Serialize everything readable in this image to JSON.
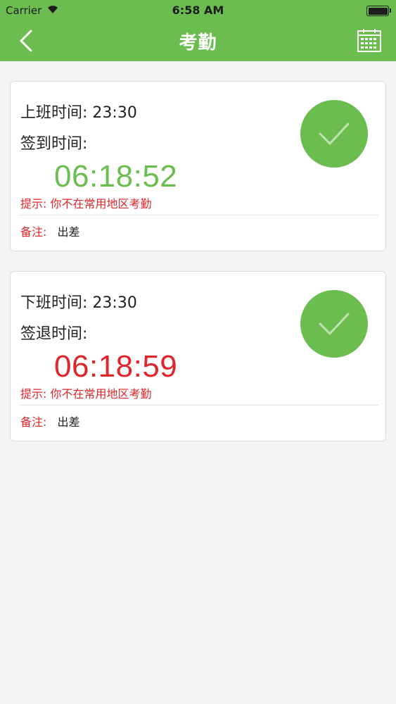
{
  "status": {
    "carrier": "Carrier",
    "time": "6:58 AM"
  },
  "nav": {
    "title": "考勤"
  },
  "checkin": {
    "shift_label": "上班时间:",
    "shift_time": "23:30",
    "sign_label": "签到时间:",
    "sign_time": "06:18:52",
    "hint": "提示: 你不在常用地区考勤",
    "remark_label": "备注:",
    "remark_value": "出差"
  },
  "checkout": {
    "shift_label": "下班时间:",
    "shift_time": "23:30",
    "sign_label": "签退时间:",
    "sign_time": "06:18:59",
    "hint": "提示: 你不在常用地区考勤",
    "remark_label": "备注:",
    "remark_value": "出差"
  },
  "colors": {
    "brand": "#6cbd4f",
    "checkin_time": "#6cbd4f",
    "checkout_time": "#e0262b",
    "warning": "#e0262b"
  },
  "icons": {
    "back": "chevron-left-icon",
    "calendar": "calendar-icon",
    "status": "checkmark-icon"
  }
}
